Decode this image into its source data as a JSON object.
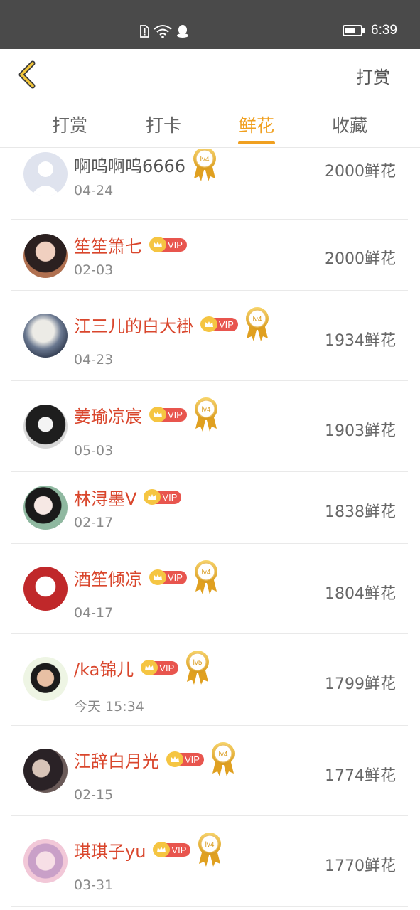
{
  "status_bar": {
    "time": "6:39"
  },
  "header": {
    "action_label": "打赏"
  },
  "tabs": [
    {
      "label": "打赏"
    },
    {
      "label": "打卡"
    },
    {
      "label": "鲜花"
    },
    {
      "label": "收藏"
    }
  ],
  "active_tab": "鲜花",
  "vip_label": "VIP",
  "rows": [
    {
      "name": "啊呜啊呜6666",
      "date": "04-24",
      "amount": "2000鲜花",
      "level": "lv4"
    },
    {
      "name": "笙笙箫七",
      "date": "02-03",
      "amount": "2000鲜花"
    },
    {
      "name": "江三儿的白大褂",
      "date": "04-23",
      "amount": "1934鲜花",
      "level": "lv4"
    },
    {
      "name": "姜瑜凉宸",
      "date": "05-03",
      "amount": "1903鲜花",
      "level": "lv4"
    },
    {
      "name": "林浔墨V",
      "date": "02-17",
      "amount": "1838鲜花"
    },
    {
      "name": "酒笙倾凉",
      "date": "04-17",
      "amount": "1804鲜花",
      "level": "lv4"
    },
    {
      "name": "/ka锦儿",
      "date": "今天 15:34",
      "amount": "1799鲜花",
      "level": "lv5"
    },
    {
      "name": "江辞白月光",
      "date": "02-15",
      "amount": "1774鲜花",
      "level": "lv4"
    },
    {
      "name": "琪琪子yu",
      "date": "03-31",
      "amount": "1770鲜花",
      "level": "lv4"
    }
  ]
}
